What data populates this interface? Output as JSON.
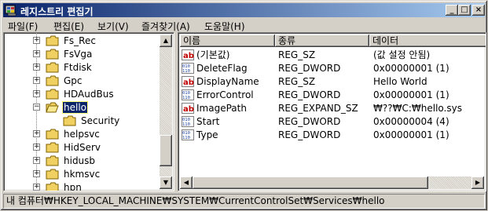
{
  "window": {
    "title": "레지스트리 편집기",
    "title_gradient": [
      "#0a246a",
      "#a6caf0"
    ]
  },
  "titlebar_buttons": {
    "minimize": "_",
    "maximize": "□",
    "close": "×"
  },
  "menu": [
    "파일(F)",
    "편집(E)",
    "보기(V)",
    "즐겨찾기(A)",
    "도움말(H)"
  ],
  "tree": {
    "items": [
      {
        "label": "Fs_Rec",
        "expander": "+"
      },
      {
        "label": "FsVga",
        "expander": "+"
      },
      {
        "label": "Ftdisk",
        "expander": "+"
      },
      {
        "label": "Gpc",
        "expander": "+"
      },
      {
        "label": "HDAudBus",
        "expander": "+"
      },
      {
        "label": "hello",
        "expander": "−",
        "selected": true
      },
      {
        "label": "Security",
        "expander": "",
        "child": true
      },
      {
        "label": "helpsvc",
        "expander": "+"
      },
      {
        "label": "HidServ",
        "expander": "+"
      },
      {
        "label": "hidusb",
        "expander": "+"
      },
      {
        "label": "hkmsvc",
        "expander": "+"
      },
      {
        "label": "hpn",
        "expander": "+"
      }
    ]
  },
  "list": {
    "columns": [
      "이름",
      "종류",
      "데이터"
    ],
    "rows": [
      {
        "icon": "string-value-icon",
        "name": "(기본값)",
        "type": "REG_SZ",
        "data": "(값 설정 안됨)"
      },
      {
        "icon": "binary-value-icon",
        "name": "DeleteFlag",
        "type": "REG_DWORD",
        "data": "0x00000001 (1)"
      },
      {
        "icon": "string-value-icon",
        "name": "DisplayName",
        "type": "REG_SZ",
        "data": "Hello World"
      },
      {
        "icon": "binary-value-icon",
        "name": "ErrorControl",
        "type": "REG_DWORD",
        "data": "0x00000001 (1)"
      },
      {
        "icon": "string-value-icon",
        "name": "ImagePath",
        "type": "REG_EXPAND_SZ",
        "data": "₩??₩C:₩hello.sys"
      },
      {
        "icon": "binary-value-icon",
        "name": "Start",
        "type": "REG_DWORD",
        "data": "0x00000004 (4)"
      },
      {
        "icon": "binary-value-icon",
        "name": "Type",
        "type": "REG_DWORD",
        "data": "0x00000001 (1)"
      }
    ]
  },
  "statusbar": {
    "path": "내 컴퓨터₩HKEY_LOCAL_MACHINE₩SYSTEM₩CurrentControlSet₩Services₩hello"
  },
  "colors": {
    "face": "#d4d0c8",
    "selection": "#0a246a",
    "folder": "#f0d060",
    "string_icon": "#c00000",
    "binary_icon": "#1a3fa0"
  }
}
